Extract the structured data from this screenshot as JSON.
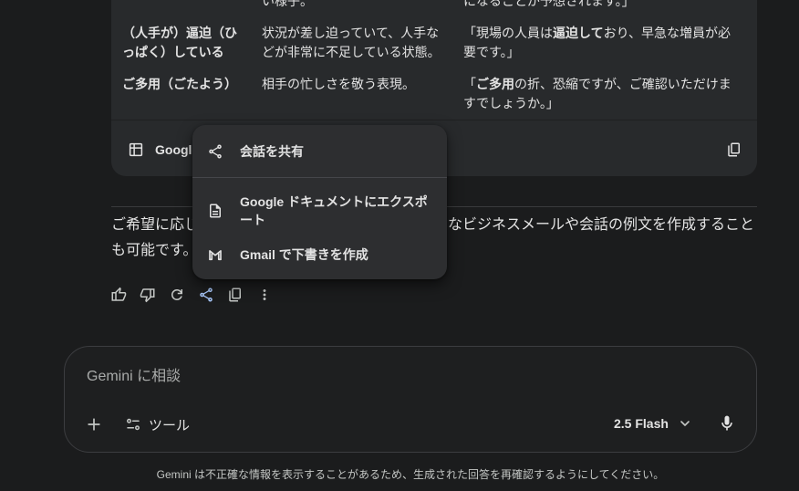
{
  "colors": {
    "page_bg": "#1b1c1d",
    "surface": "#282a2c",
    "menu_bg": "#2d2e30",
    "text": "#e3e3e3",
    "text_secondary": "#c4c7c5",
    "accent": "#a8c7fa",
    "border": "#3c3d40"
  },
  "table": {
    "rows": [
      {
        "meaning": "い様子。",
        "example": {
          "pre": "になることが予想されます。」"
        }
      },
      {
        "term": "（人手が）逼迫（ひっぱく）している",
        "meaning": "状況が差し迫っていて、人手などが非常に不足している状態。",
        "example": {
          "pre": "「現場の人員は",
          "bold": "逼迫して",
          "post": "おり、早急な増員が必要です。」"
        }
      },
      {
        "term": "ご多用（ごたよう）",
        "meaning": "相手の忙しさを敬う表現。",
        "example": {
          "pre": "「",
          "bold": "ご多用",
          "post": "の折、恐縮ですが、ご確認いただけますでしょうか。」"
        }
      }
    ],
    "footer": {
      "export_label": "Google",
      "export_icon": "table-icon",
      "copy_icon": "copy-icon"
    }
  },
  "response": {
    "paragraph": {
      "line1_start": "ご希望に応じ",
      "line1_end": "なビジネスメールや会話の例文を作成すること",
      "line2_start": "も可能です。"
    },
    "actions": [
      {
        "icon": "thumb-up-icon"
      },
      {
        "icon": "thumb-down-icon"
      },
      {
        "icon": "refresh-icon"
      },
      {
        "icon": "share-icon",
        "active": true
      },
      {
        "icon": "copy-icon"
      },
      {
        "icon": "more-vert-icon"
      }
    ]
  },
  "share_menu": {
    "items": [
      {
        "label": "会話を共有",
        "icon": "share-icon"
      },
      {
        "label": "Google ドキュメントにエクスポート",
        "icon": "document-icon"
      },
      {
        "label": "Gmail で下書きを作成",
        "icon": "gmail-icon"
      }
    ]
  },
  "composer": {
    "placeholder": "Gemini に相談",
    "tools_label": "ツール",
    "model_label": "2.5 Flash"
  },
  "disclaimer": "Gemini は不正確な情報を表示することがあるため、生成された回答を再確認するようにしてください。"
}
